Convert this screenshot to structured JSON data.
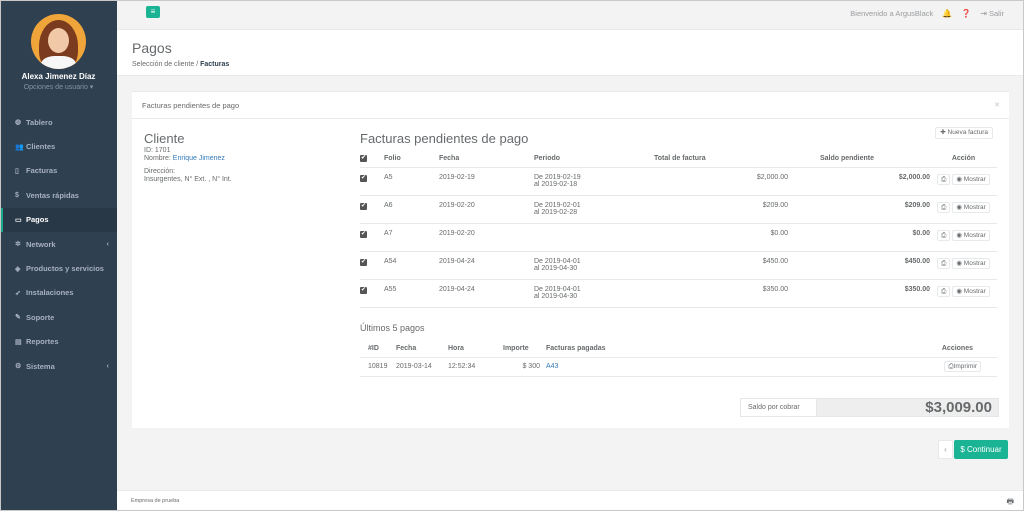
{
  "colors": {
    "sidebar": "#2f4050",
    "accent": "#1ab394",
    "link": "#337ab7"
  },
  "profile": {
    "name": "Alexa Jimenez Díaz",
    "options": "Opciones de usuario ▾"
  },
  "sidebar": {
    "items": [
      {
        "icon": "dashboard-icon",
        "glyph": "◍",
        "label": "Tablero",
        "caret": ""
      },
      {
        "icon": "users-icon",
        "glyph": "👥",
        "label": "Clientes",
        "caret": ""
      },
      {
        "icon": "file-icon",
        "glyph": "▯",
        "label": "Facturas",
        "caret": ""
      },
      {
        "icon": "dollar-icon",
        "glyph": "$",
        "label": "Ventas rápidas",
        "caret": ""
      },
      {
        "icon": "card-icon",
        "glyph": "▭",
        "label": "Pagos",
        "caret": ""
      },
      {
        "icon": "network-icon",
        "glyph": "✲",
        "label": "Network",
        "caret": "‹"
      },
      {
        "icon": "tag-icon",
        "glyph": "◈",
        "label": "Productos y servicios",
        "caret": ""
      },
      {
        "icon": "rocket-icon",
        "glyph": "➶",
        "label": "Instalaciones",
        "caret": ""
      },
      {
        "icon": "wrench-icon",
        "glyph": "✎",
        "label": "Soporte",
        "caret": ""
      },
      {
        "icon": "report-icon",
        "glyph": "▤",
        "label": "Reportes",
        "caret": ""
      },
      {
        "icon": "cogs-icon",
        "glyph": "⚙",
        "label": "Sistema",
        "caret": "‹"
      }
    ],
    "active_index": 4
  },
  "topbar": {
    "welcome": "Bienvenido a ArgusBlack",
    "logout": "Salir"
  },
  "page": {
    "title": "Pagos",
    "crumb_parent": "Selección de cliente /",
    "crumb_current": "Facturas"
  },
  "panel": {
    "title": "Facturas pendientes de pago"
  },
  "client": {
    "heading": "Cliente",
    "id_line": "ID: 1701",
    "name_label": "Nombre:",
    "name_value": "Enrique Jimenez",
    "address_label": "Dirección:",
    "address_value": "Insurgentes, N° Ext. , N° Int."
  },
  "invoices": {
    "heading": "Facturas pendientes de pago",
    "new_button": "Nueva factura",
    "columns": [
      "Folio",
      "Fecha",
      "Periodo",
      "Total de factura",
      "Saldo pendiente",
      "Acción"
    ],
    "show_label": "Mostrar",
    "rows": [
      {
        "folio": "A5",
        "date": "2019-02-19",
        "period1": "De 2019-02-19",
        "period2": "al 2019-02-18",
        "total": "$2,000.00",
        "balance": "$2,000.00"
      },
      {
        "folio": "A6",
        "date": "2019-02-20",
        "period1": "De 2019-02-01",
        "period2": "al 2019-02-28",
        "total": "$209.00",
        "balance": "$209.00"
      },
      {
        "folio": "A7",
        "date": "2019-02-20",
        "period1": "",
        "period2": "",
        "total": "$0.00",
        "balance": "$0.00"
      },
      {
        "folio": "A54",
        "date": "2019-04-24",
        "period1": "De 2019-04-01",
        "period2": "al 2019-04-30",
        "total": "$450.00",
        "balance": "$450.00"
      },
      {
        "folio": "A55",
        "date": "2019-04-24",
        "period1": "De 2019-04-01",
        "period2": "al 2019-04-30",
        "total": "$350.00",
        "balance": "$350.00"
      }
    ]
  },
  "payments": {
    "heading": "Últimos 5 pagos",
    "columns": [
      "#ID",
      "Fecha",
      "Hora",
      "Importe",
      "Facturas pagadas",
      "Acciones"
    ],
    "print_label": "Imprimir",
    "rows": [
      {
        "id": "10819",
        "date": "2019-03-14",
        "time": "12:52:34",
        "amount": "$ 300",
        "invoices": "A43"
      }
    ]
  },
  "balance": {
    "label": "Saldo por cobrar",
    "value": "$3,009.00"
  },
  "actions": {
    "prev": "‹",
    "continue": "$ Continuar"
  },
  "footer": {
    "company": "Empresa de prueba"
  }
}
